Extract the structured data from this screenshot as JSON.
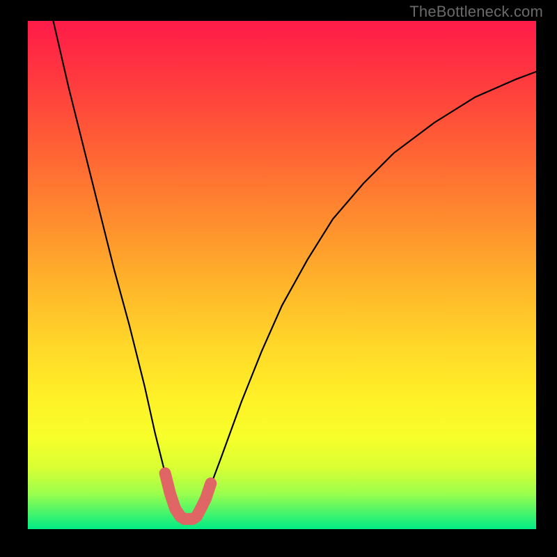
{
  "attribution": "TheBottleneck.com",
  "colors": {
    "frame": "#000000",
    "curve": "#000000",
    "marker": "#e06666",
    "gradient_top": "#ff1b49",
    "gradient_bottom": "#00eb85"
  },
  "chart_data": {
    "type": "line",
    "title": "",
    "xlabel": "",
    "ylabel": "",
    "xlim": [
      0,
      100
    ],
    "ylim": [
      0,
      100
    ],
    "grid": false,
    "series": [
      {
        "name": "curve",
        "x": [
          5,
          8,
          11,
          14,
          17,
          20,
          23,
          25,
          27,
          28.5,
          30,
          31.5,
          33,
          35,
          38,
          42,
          46,
          50,
          55,
          60,
          66,
          72,
          80,
          88,
          96,
          100
        ],
        "y": [
          100,
          87,
          75,
          63,
          51,
          40,
          28,
          19,
          11,
          6,
          2.5,
          2,
          2.5,
          6,
          14,
          25,
          35,
          44,
          53,
          61,
          68,
          74,
          80,
          85,
          88.5,
          90
        ]
      },
      {
        "name": "marker",
        "x": [
          27,
          28,
          29,
          30,
          30.8,
          31.6,
          32.4,
          33.2,
          34,
          35,
          36
        ],
        "y": [
          11,
          7,
          4,
          2.5,
          2,
          2,
          2,
          2.5,
          4,
          6,
          9
        ]
      }
    ],
    "annotations": []
  }
}
